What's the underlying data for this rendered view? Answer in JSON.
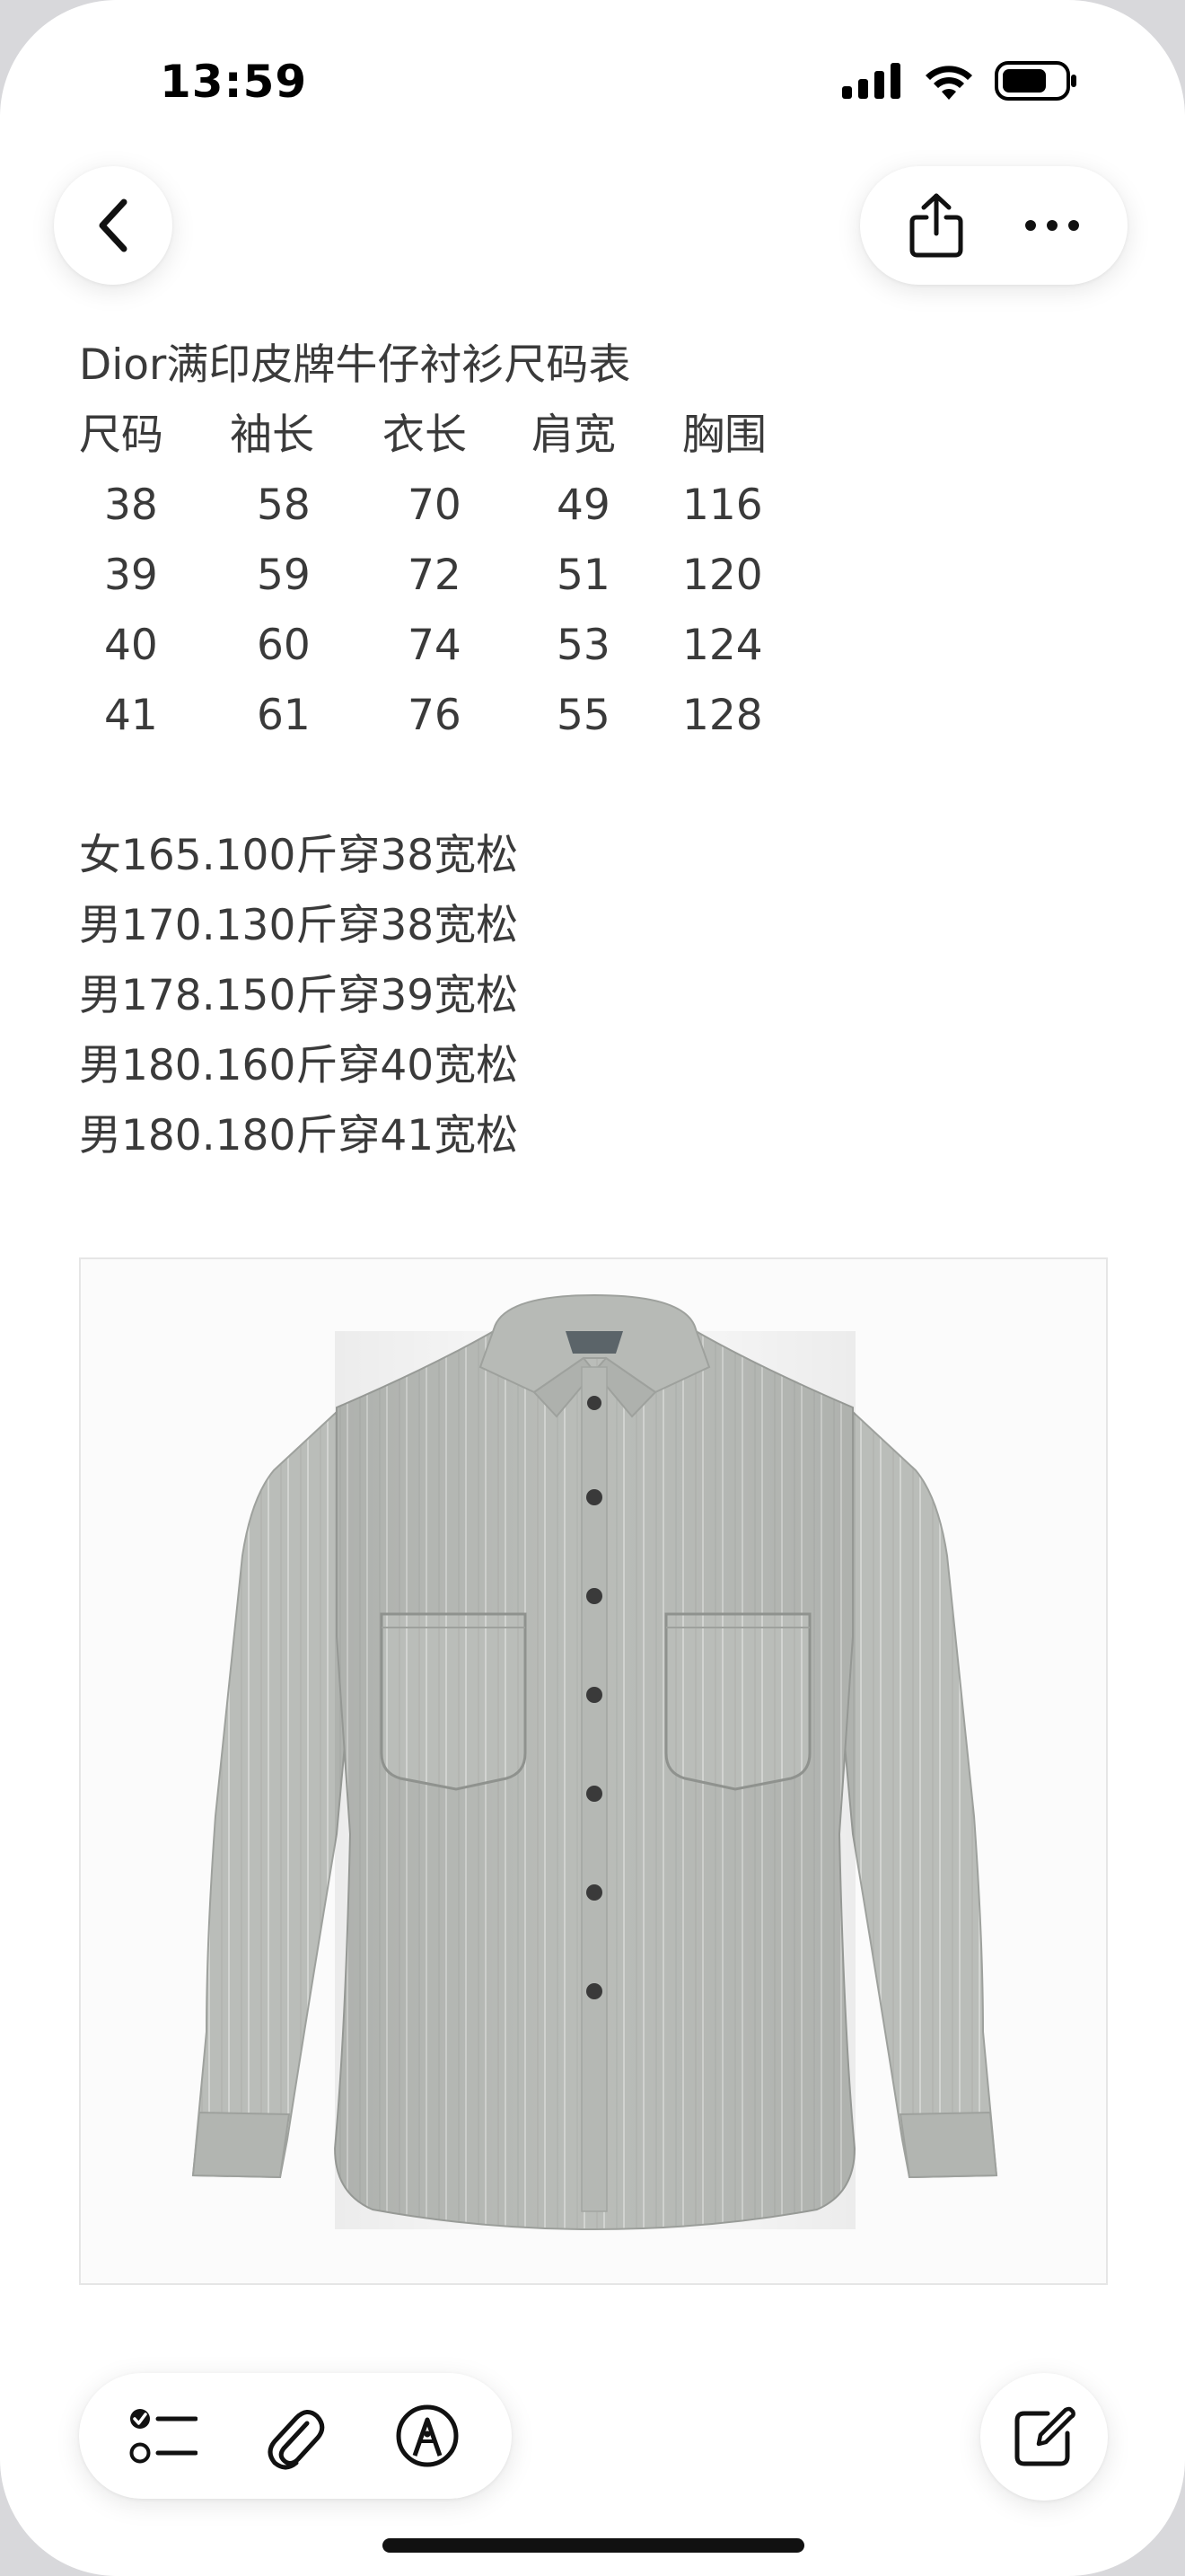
{
  "status_bar": {
    "time": "13:59"
  },
  "toolbar": {
    "back_icon": "chevron-left-icon",
    "share_icon": "share-icon",
    "more_icon": "ellipsis-icon"
  },
  "note": {
    "title": "Dior满印皮牌牛仔衬衫尺码表",
    "table": {
      "headers": [
        "尺码",
        "袖长",
        "衣长",
        "肩宽",
        "胸围"
      ],
      "rows": [
        [
          "38",
          "58",
          "70",
          "49",
          "116"
        ],
        [
          "39",
          "59",
          "72",
          "51",
          "120"
        ],
        [
          "40",
          "60",
          "74",
          "53",
          "124"
        ],
        [
          "41",
          "61",
          "76",
          "55",
          "128"
        ]
      ]
    },
    "recommendations": [
      "女165.100斤穿38宽松",
      "男170.130斤穿38宽松",
      "男178.150斤穿39宽松",
      "男180.160斤穿40宽松",
      "男180.180斤穿41宽松"
    ]
  },
  "bottom_bar": {
    "checklist_icon": "checklist-icon",
    "attachment_icon": "paperclip-icon",
    "markup_icon": "markup-pen-icon",
    "compose_icon": "compose-icon"
  },
  "colors": {
    "text": "#3a3a3a",
    "shirt": "#b9bcb8",
    "background": "#ffffff"
  }
}
